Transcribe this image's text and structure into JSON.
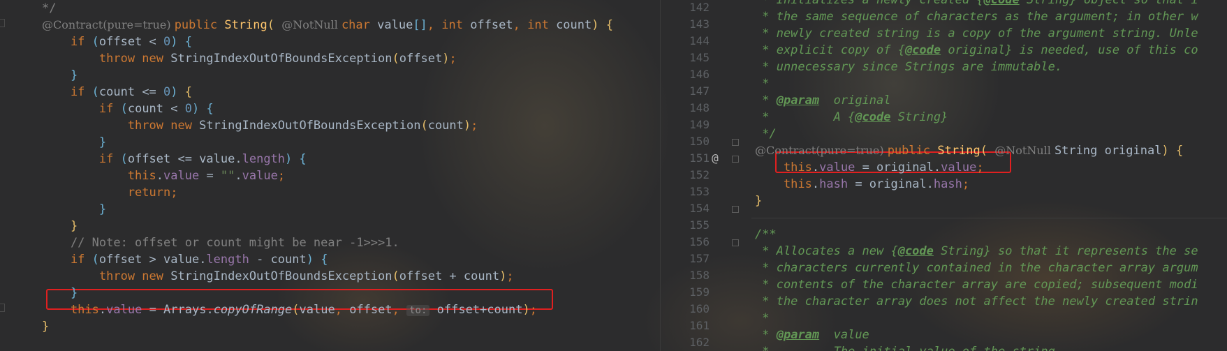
{
  "left_editor": {
    "lines": [
      [
        [
          "cmt",
          "*/"
        ]
      ],
      [
        [
          "ann",
          "@Contract(pure=true) "
        ],
        [
          "kw",
          "public "
        ],
        [
          "meth",
          "String"
        ],
        [
          "bl1",
          "( "
        ],
        [
          "ann",
          "@NotNull "
        ],
        [
          "kw",
          "char "
        ],
        [
          "plain",
          "value"
        ],
        [
          "bl2",
          "[]"
        ],
        [
          "kw",
          ", int "
        ],
        [
          "plain",
          "offset"
        ],
        [
          "kw",
          ", int "
        ],
        [
          "plain",
          "count"
        ],
        [
          "bl1",
          ") "
        ],
        [
          "bl1",
          "{"
        ]
      ],
      [
        [
          "kw",
          "    if "
        ],
        [
          "bl2",
          "("
        ],
        [
          "plain",
          "offset < "
        ],
        [
          "num",
          "0"
        ],
        [
          "bl2",
          ") "
        ],
        [
          "bl2",
          "{"
        ]
      ],
      [
        [
          "kw",
          "        throw new "
        ],
        [
          "plain",
          "StringIndexOutOfBoundsException"
        ],
        [
          "bl1",
          "("
        ],
        [
          "plain",
          "offset"
        ],
        [
          "bl1",
          ")"
        ],
        [
          "kw",
          ";"
        ]
      ],
      [
        [
          "bl2",
          "    }"
        ]
      ],
      [
        [
          "kw",
          "    if "
        ],
        [
          "bl2",
          "("
        ],
        [
          "plain",
          "count <= "
        ],
        [
          "num",
          "0"
        ],
        [
          "bl2",
          ") "
        ],
        [
          "bl1",
          "{"
        ]
      ],
      [
        [
          "kw",
          "        if "
        ],
        [
          "bl2",
          "("
        ],
        [
          "plain",
          "count < "
        ],
        [
          "num",
          "0"
        ],
        [
          "bl2",
          ") "
        ],
        [
          "bl2",
          "{"
        ]
      ],
      [
        [
          "kw",
          "            throw new "
        ],
        [
          "plain",
          "StringIndexOutOfBoundsException"
        ],
        [
          "bl1",
          "("
        ],
        [
          "plain",
          "count"
        ],
        [
          "bl1",
          ")"
        ],
        [
          "kw",
          ";"
        ]
      ],
      [
        [
          "bl2",
          "        }"
        ]
      ],
      [
        [
          "kw",
          "        if "
        ],
        [
          "bl2",
          "("
        ],
        [
          "plain",
          "offset <= value."
        ],
        [
          "fld",
          "length"
        ],
        [
          "bl2",
          ") "
        ],
        [
          "bl2",
          "{"
        ]
      ],
      [
        [
          "kw",
          "            this"
        ],
        [
          "plain",
          "."
        ],
        [
          "fld",
          "value"
        ],
        [
          "plain",
          " = "
        ],
        [
          "str",
          "\"\""
        ],
        [
          "plain",
          "."
        ],
        [
          "fld",
          "value"
        ],
        [
          "kw",
          ";"
        ]
      ],
      [
        [
          "kw",
          "            return;"
        ]
      ],
      [
        [
          "bl2",
          "        }"
        ]
      ],
      [
        [
          "bl1",
          "    }"
        ]
      ],
      [
        [
          "cmt",
          "    // Note: offset or count might be near -1>>>1."
        ]
      ],
      [
        [
          "kw",
          "    if "
        ],
        [
          "bl2",
          "("
        ],
        [
          "plain",
          "offset > value."
        ],
        [
          "fld",
          "length"
        ],
        [
          "plain",
          " - count"
        ],
        [
          "bl2",
          ") "
        ],
        [
          "bl2",
          "{"
        ]
      ],
      [
        [
          "kw",
          "        throw new "
        ],
        [
          "plain",
          "StringIndexOutOfBoundsException"
        ],
        [
          "bl1",
          "("
        ],
        [
          "plain",
          "offset + count"
        ],
        [
          "bl1",
          ")"
        ],
        [
          "kw",
          ";"
        ]
      ],
      [
        [
          "bl2",
          "    }"
        ]
      ],
      [
        [
          "kw",
          "    this"
        ],
        [
          "plain",
          "."
        ],
        [
          "fld",
          "value"
        ],
        [
          "plain",
          " = Arrays."
        ],
        [
          "stmeth",
          "copyOfRange"
        ],
        [
          "bl1",
          "("
        ],
        [
          "plain",
          "value"
        ],
        [
          "kw",
          ", "
        ],
        [
          "plain",
          "offset"
        ],
        [
          "kw",
          ", "
        ],
        [
          "hint",
          "to:"
        ],
        [
          "plain",
          " offset+count"
        ],
        [
          "bl1",
          ")"
        ],
        [
          "kw",
          ";"
        ]
      ],
      [
        [
          "bl1",
          "}"
        ]
      ]
    ]
  },
  "right_editor": {
    "line_numbers": [
      "142",
      "143",
      "144",
      "145",
      "146",
      "147",
      "148",
      "149",
      "150",
      "151",
      "152",
      "153",
      "154",
      "155",
      "156",
      "157",
      "158",
      "159",
      "160",
      "161",
      "162"
    ],
    "gutter_at_symbol": "@",
    "lines": [
      [
        [
          "jdoc",
          " * Initializes a newly created "
        ],
        [
          "jdoc",
          "{"
        ],
        [
          "jtag",
          "@code"
        ],
        [
          "jdoc",
          " String} object so that i"
        ]
      ],
      [
        [
          "jdoc",
          " * the same sequence of characters as the argument; in other w"
        ]
      ],
      [
        [
          "jdoc",
          " * newly created string is a copy of the argument string. Unle"
        ]
      ],
      [
        [
          "jdoc",
          " * explicit copy of {"
        ],
        [
          "jtag",
          "@code"
        ],
        [
          "jdoc",
          " original} is needed, use of this co"
        ]
      ],
      [
        [
          "jdoc",
          " * unnecessary since Strings are immutable."
        ]
      ],
      [
        [
          "jdoc",
          " *"
        ]
      ],
      [
        [
          "jdoc",
          " * "
        ],
        [
          "jtag",
          "@param"
        ],
        [
          "jdoc",
          "  original"
        ]
      ],
      [
        [
          "jdoc",
          " *         A {"
        ],
        [
          "jtag",
          "@code"
        ],
        [
          "jdoc",
          " String}"
        ]
      ],
      [
        [
          "jdoc",
          " */"
        ]
      ],
      [
        [
          "ann",
          "@Contract(pure=true) "
        ],
        [
          "kw",
          "public "
        ],
        [
          "meth",
          "String"
        ],
        [
          "bl1",
          "( "
        ],
        [
          "ann",
          "@NotNull "
        ],
        [
          "plain",
          "String original"
        ],
        [
          "bl1",
          ") {"
        ]
      ],
      [
        [
          "kw",
          "    this"
        ],
        [
          "plain",
          "."
        ],
        [
          "fld",
          "value"
        ],
        [
          "plain",
          " = original."
        ],
        [
          "fld",
          "value"
        ],
        [
          "kw",
          ";"
        ]
      ],
      [
        [
          "kw",
          "    this"
        ],
        [
          "plain",
          "."
        ],
        [
          "fld",
          "hash"
        ],
        [
          "plain",
          " = original."
        ],
        [
          "fld",
          "hash"
        ],
        [
          "kw",
          ";"
        ]
      ],
      [
        [
          "bl1",
          "}"
        ]
      ],
      [
        [
          "plain",
          ""
        ]
      ],
      [
        [
          "jdoc",
          "/**"
        ]
      ],
      [
        [
          "jdoc",
          " * Allocates a new {"
        ],
        [
          "jtag",
          "@code"
        ],
        [
          "jdoc",
          " String} so that it represents the se"
        ]
      ],
      [
        [
          "jdoc",
          " * characters currently contained in the character array argum"
        ]
      ],
      [
        [
          "jdoc",
          " * contents of the character array are copied; subsequent modi"
        ]
      ],
      [
        [
          "jdoc",
          " * the character array does not affect the newly created strin"
        ]
      ],
      [
        [
          "jdoc",
          " *"
        ]
      ],
      [
        [
          "jdoc",
          " * "
        ],
        [
          "jtag",
          "@param"
        ],
        [
          "jdoc",
          "  value"
        ]
      ],
      [
        [
          "jdoc",
          " *         The initial value of the string"
        ]
      ]
    ]
  }
}
